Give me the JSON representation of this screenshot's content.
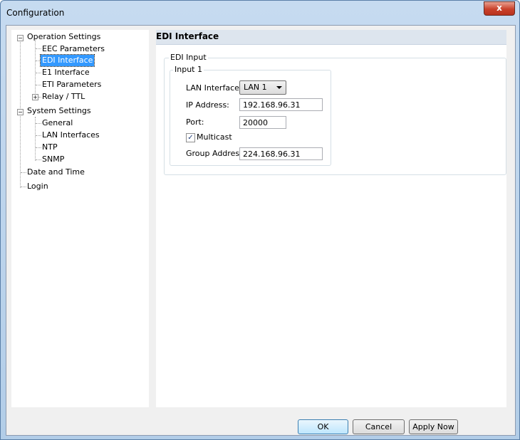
{
  "window": {
    "title": "Configuration",
    "close_glyph": "x"
  },
  "tree": {
    "operation_settings": "Operation Settings",
    "eec_parameters": "EEC Parameters",
    "edi_interface": "EDI Interface",
    "e1_interface": "E1 Interface",
    "eti_parameters": "ETI Parameters",
    "relay_ttl": "Relay / TTL",
    "system_settings": "System Settings",
    "general": "General",
    "lan_interfaces": "LAN Interfaces",
    "ntp": "NTP",
    "snmp": "SNMP",
    "date_and_time": "Date and Time",
    "login": "Login",
    "collapse_glyph": "−",
    "expand_glyph": "+"
  },
  "panel": {
    "title": "EDI Interface",
    "edi_input_label": "EDI Input",
    "input1_label": "Input 1",
    "lan_interface_label": "LAN Interface:",
    "lan_interface_value": "LAN 1",
    "ip_address_label": "IP Address:",
    "ip_address_value": "192.168.96.31",
    "port_label": "Port:",
    "port_value": "20000",
    "multicast_label": "Multicast",
    "multicast_checked": true,
    "check_glyph": "✓",
    "group_address_label": "Group Address:",
    "group_address_value": "224.168.96.31"
  },
  "buttons": {
    "ok": "OK",
    "cancel": "Cancel",
    "apply_now": "Apply Now"
  }
}
